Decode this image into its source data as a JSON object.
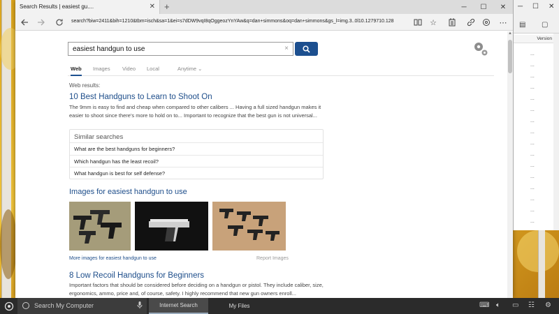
{
  "browser": {
    "tab_title": "Search Results | easiest gu....",
    "tab_close": "✕",
    "new_tab": "+",
    "window_controls": {
      "minimize": "─",
      "maximize": "☐",
      "close": "✕"
    },
    "address": "search?biw=2411&bih=1210&tbm=isch&sa=1&ei=s7dDW9vqI8qOggeozYnYAw&q=dan+simmons&oq=dan+simmons&gs_l=img.3..0l10.1279710.128"
  },
  "search": {
    "query": "easiest handgun to use",
    "clear": "×"
  },
  "vertical_tabs": [
    {
      "label": "Web",
      "active": true
    },
    {
      "label": "Images",
      "active": false
    },
    {
      "label": "Video",
      "active": false
    },
    {
      "label": "Local",
      "active": false
    },
    {
      "label": "Anytime ⌄",
      "active": false
    }
  ],
  "web_results_label": "Web results:",
  "result1": {
    "title": "10 Best Handguns to Learn to Shoot On",
    "snippet": "The 9mm is easy to find and cheap when compared to other calibers ... Having a full sized handgun makes it easier to shoot since there's more to hold on to... Important to recognize that the best gun is not universal..."
  },
  "similar": {
    "heading": "Similar searches",
    "items": [
      "What are the best handguns for beginners?",
      "Which handgun has the least recoil?",
      "What handgun is best for self defense?"
    ]
  },
  "images_section": {
    "heading": "Images for easiest handgun to use",
    "more_link": "More images for easiest handgun to use",
    "report": "Report Images"
  },
  "result2": {
    "title": "8 Low Recoil Handguns for Beginners",
    "snippet": "Important factors that should be considered before deciding on a handgun or pistol. They include caliber, size, ergonomics, ammo, price and, of course, safety. I highly recommend that new gun owners enroll..."
  },
  "side_window": {
    "column_header": "Version",
    "rows": [
      "...",
      "...",
      "...",
      "...",
      "...",
      "...",
      "...",
      "...",
      "...",
      "...",
      "...",
      "...",
      "...",
      "...",
      "...",
      "..."
    ]
  },
  "taskbar": {
    "search_placeholder": "Search My Computer",
    "tasks": [
      "Internet Search",
      "My Files"
    ]
  }
}
